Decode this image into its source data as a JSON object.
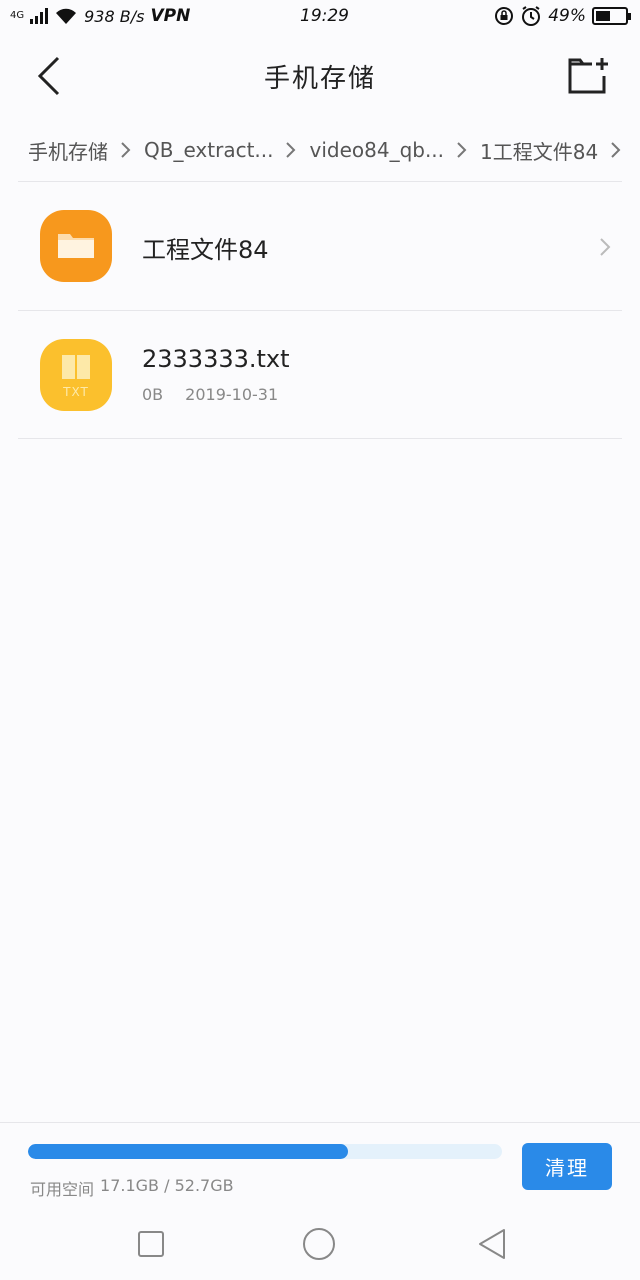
{
  "status_bar": {
    "network": "4G",
    "speed": "938 B/s",
    "vpn": "VPN",
    "time": "19:29",
    "battery": "49%",
    "battery_level": 0.49
  },
  "header": {
    "title": "手机存储",
    "back_icon": "chevron-left-icon",
    "new_folder_icon": "new-folder-icon"
  },
  "breadcrumb": [
    "手机存储",
    "QB_extract...",
    "video84_qb...",
    "1工程文件84"
  ],
  "files": [
    {
      "name": "工程文件84",
      "type": "folder",
      "icon": "folder-icon"
    },
    {
      "name": "2333333.txt",
      "type": "txt",
      "icon": "txt-file-icon",
      "icon_label": "TXT",
      "size": "0B",
      "date": "2019-10-31"
    }
  ],
  "storage": {
    "label": "可用空间",
    "value": "17.1GB / 52.7GB",
    "used_fraction": 0.675,
    "clean_label": "清理"
  },
  "colors": {
    "accent": "#2a8ae8",
    "folder": "#f7981d",
    "txt": "#fbc02d"
  }
}
